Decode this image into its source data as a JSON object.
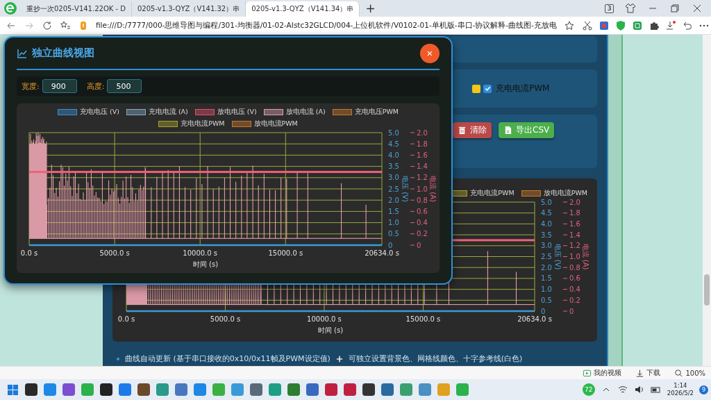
{
  "browser": {
    "tabs": [
      {
        "title": "重抄一次0205-V141.22OK - D",
        "selected": false
      },
      {
        "title": "0205-v1.3-QYZ（V141.32）串",
        "selected": false
      },
      {
        "title": "0205-v1.3-QYZ（V141.34）串",
        "selected": true
      }
    ],
    "new_tab": "+",
    "tab_count": "3",
    "address": "file:///D:/7777/000-思维导图与编程/301-均衡器/01-02-AIstc32GLCD/004-上位机软件/V0102-01-单机版-串口-协议解释-曲线图-充放电"
  },
  "page": {
    "series_toggle": {
      "label": "充电电流PWM",
      "checked": true,
      "color": "#f5c518"
    },
    "buttons": [
      {
        "label": "清除",
        "kind": "danger"
      },
      {
        "label": "导出CSV",
        "kind": "export"
      }
    ],
    "chart": {
      "legend": [
        {
          "label": "充电电流PWM",
          "color": "#a8a030"
        },
        {
          "label": "放电电流PWM",
          "color": "#c8782a"
        }
      ],
      "x_ticks": [
        "0.0 s",
        "5000.0 s",
        "10000.0 s",
        "15000.0 s",
        "20634.0 s"
      ],
      "voltage_ticks": [
        "5.0",
        "4.5",
        "4.0",
        "3.5",
        "3.0",
        "2.5",
        "2.0",
        "1.5",
        "1.0",
        "0.5",
        "0"
      ],
      "current_ticks": [
        "2.0",
        "1.8",
        "1.6",
        "1.4",
        "1.2",
        "1.0",
        "0.8",
        "0.6",
        "0.4",
        "0.2",
        "0"
      ],
      "x_title": "时间 (s)",
      "voltage_title": "电压 (V)",
      "current_title": "电流 (A)"
    },
    "notes": [
      {
        "kind": "bullet",
        "text": "曲线自动更新 (基于串口接收的0x10/0x11帧及PWM设定值)"
      },
      {
        "kind": "plus",
        "text": "可独立设置背景色、网格线颜色、十字参考线(白色)"
      }
    ]
  },
  "dialog": {
    "title": "独立曲线视图",
    "close": "×",
    "width_label": "宽度:",
    "width_value": "900",
    "height_label": "高度:",
    "height_value": "500",
    "chart": {
      "legend": [
        {
          "label": "充电电压 (V)",
          "color": "#3a8fd0"
        },
        {
          "label": "充电电流 (A)",
          "color": "#7fa9c4"
        },
        {
          "label": "放电电压 (V)",
          "color": "#e0506e"
        },
        {
          "label": "放电电流 (A)",
          "color": "#d9a0ac"
        },
        {
          "label": "充电电压PWM",
          "color": "#c8782a"
        },
        {
          "label": "充电电流PWM",
          "color": "#a8a030"
        },
        {
          "label": "放电电流PWM",
          "color": "#c8782a"
        }
      ],
      "x_ticks": [
        "0.0 s",
        "5000.0 s",
        "10000.0 s",
        "15000.0 s",
        "20634.0 s"
      ],
      "voltage_ticks": [
        "5.0",
        "4.5",
        "4.0",
        "3.5",
        "3.0",
        "2.5",
        "2.0",
        "1.5",
        "1.0",
        "0.5",
        "0"
      ],
      "current_ticks": [
        "2.0",
        "1.8",
        "1.6",
        "1.4",
        "1.2",
        "1.0",
        "0.8",
        "0.6",
        "0.4",
        "0.2",
        "0"
      ],
      "x_title": "时间 (s)",
      "voltage_title": "电压 (V)",
      "current_title": "电流 (A)"
    }
  },
  "status_bar": {
    "items": [
      {
        "kind": "video",
        "label": "我的视频"
      },
      {
        "kind": "download",
        "label": "下载"
      },
      {
        "kind": "zoom",
        "label": "100%"
      }
    ]
  },
  "taskbar": {
    "badge": "72",
    "time": "1:14",
    "date": "2026/5/2",
    "notifications": "9"
  }
}
